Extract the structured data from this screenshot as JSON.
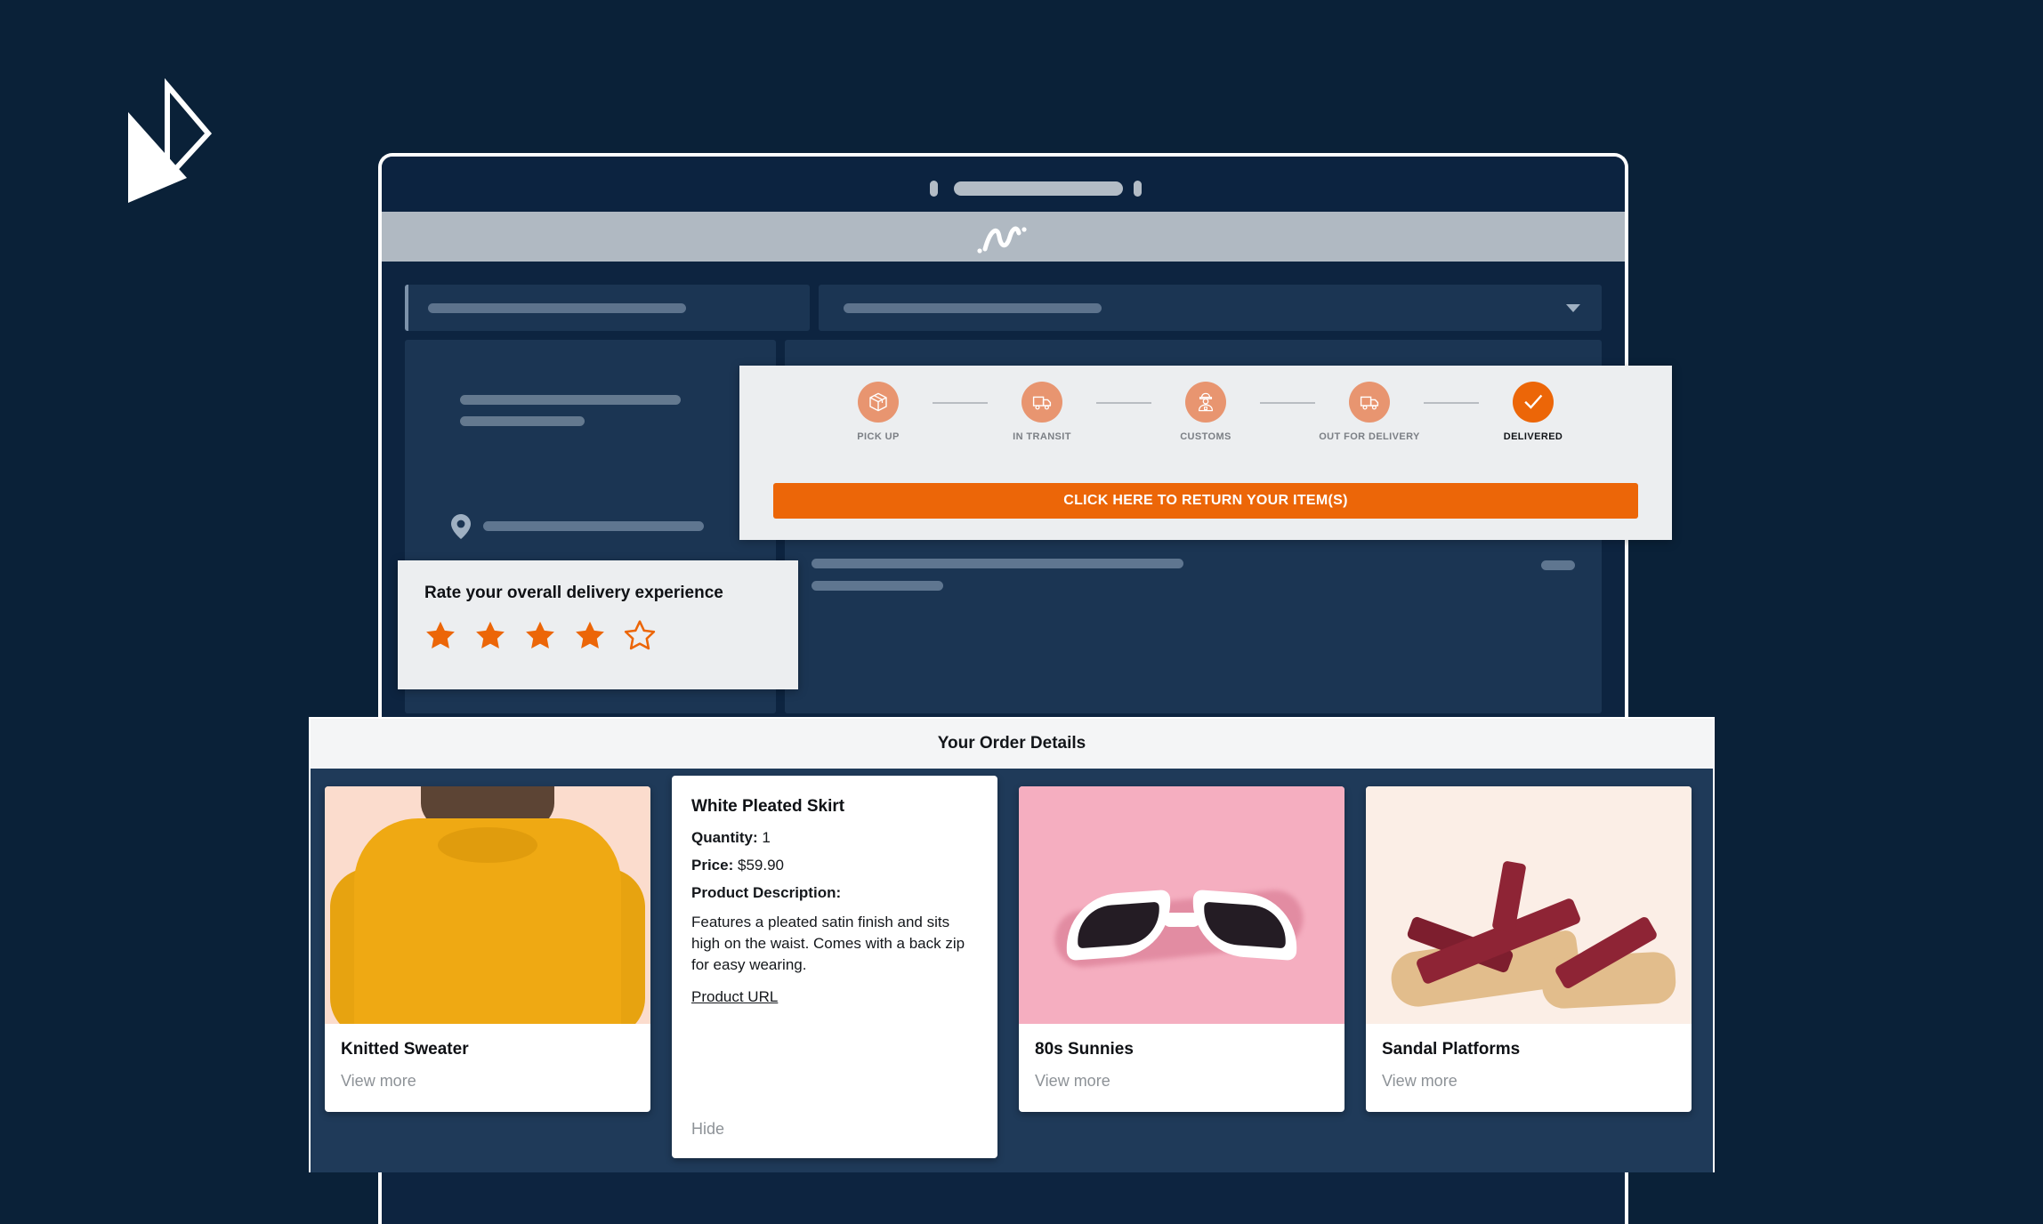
{
  "brand": {
    "mark_name": "double-triangle-play-logo",
    "site_logo_name": "squiggle-wave-logo",
    "accent": "#ec6608",
    "accent_muted": "#e89570",
    "page_bg": "#0a2138",
    "panel_bg": "#1b3553",
    "card_bg": "#eceef0"
  },
  "browser": {
    "titlebar_name": "browser-titlebar",
    "site_header_name": "site-header"
  },
  "search": {
    "field_placeholder": "",
    "dropdown_placeholder": ""
  },
  "tracker": {
    "steps": [
      {
        "label": "PICK UP",
        "icon": "package-box-icon",
        "state": "pending"
      },
      {
        "label": "IN TRANSIT",
        "icon": "delivery-truck-icon",
        "state": "pending"
      },
      {
        "label": "CUSTOMS",
        "icon": "customs-officer-icon",
        "state": "pending"
      },
      {
        "label": "OUT FOR DELIVERY",
        "icon": "delivery-truck-icon",
        "state": "pending"
      },
      {
        "label": "DELIVERED",
        "icon": "check-mark-icon",
        "state": "done"
      }
    ],
    "return_button_label": "CLICK HERE TO RETURN YOUR ITEM(S)"
  },
  "rating": {
    "title": "Rate your overall delivery experience",
    "stars_total": 5,
    "stars_filled": 4
  },
  "orders": {
    "title": "Your Order Details",
    "cards": [
      {
        "type": "photo",
        "name": "Knitted Sweater",
        "action_label": "View more",
        "image_name": "knitted-sweater-photo"
      },
      {
        "type": "detail",
        "name": "White Pleated Skirt",
        "quantity_label": "Quantity:",
        "quantity_value": "1",
        "price_label": "Price:",
        "price_value": "$59.90",
        "description_label": "Product Description:",
        "description": "Features a pleated satin finish and sits high on the waist. Comes with a back zip for easy wearing.",
        "url_label": "Product URL",
        "hide_label": "Hide"
      },
      {
        "type": "photo",
        "name": "80s Sunnies",
        "action_label": "View more",
        "image_name": "sunglasses-photo"
      },
      {
        "type": "photo",
        "name": "Sandal Platforms",
        "action_label": "View more",
        "image_name": "platform-sandals-photo"
      }
    ]
  }
}
